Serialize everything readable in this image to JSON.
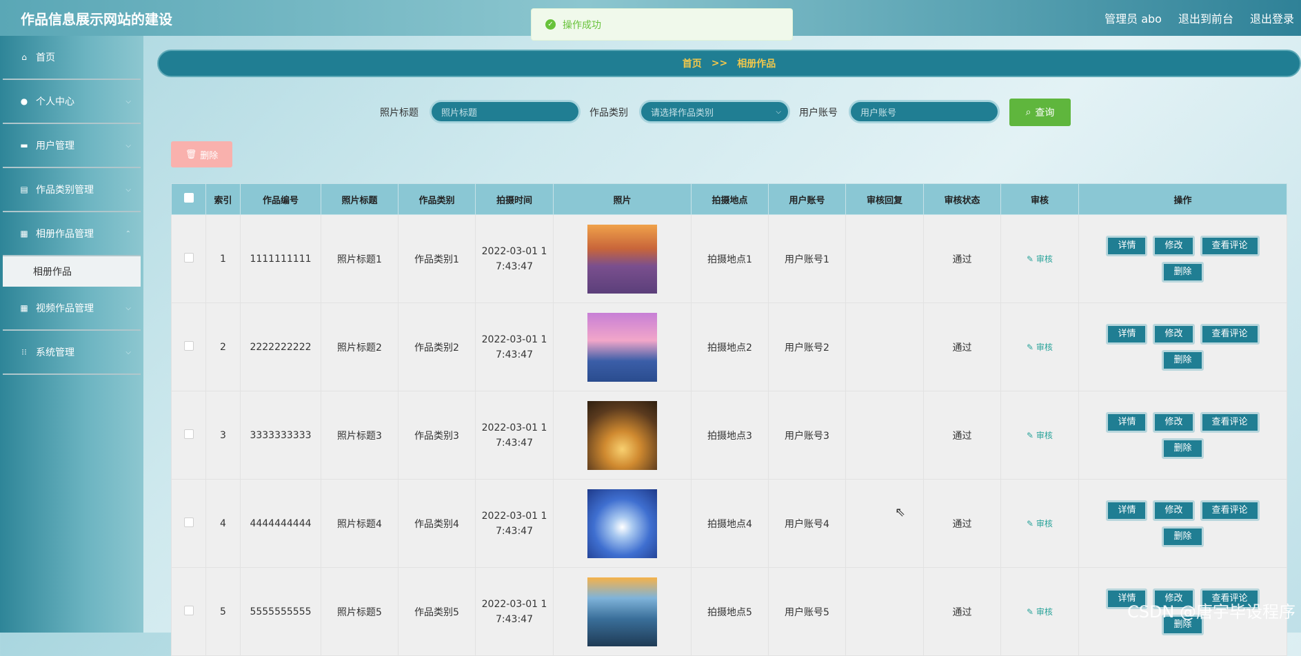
{
  "header": {
    "title": "作品信息展示网站的建设",
    "user_label": "管理员 abo",
    "to_front": "退出到前台",
    "logout": "退出登录"
  },
  "toast": {
    "message": "操作成功",
    "icon": "check-circle-icon"
  },
  "sidebar": {
    "items": [
      {
        "label": "首页",
        "icon": "home-icon"
      },
      {
        "label": "个人中心",
        "icon": "user-icon"
      },
      {
        "label": "用户管理",
        "icon": "briefcase-icon"
      },
      {
        "label": "作品类别管理",
        "icon": "clipboard-icon"
      },
      {
        "label": "相册作品管理",
        "icon": "ticket-icon"
      },
      {
        "label": "视频作品管理",
        "icon": "grid-icon"
      },
      {
        "label": "系统管理",
        "icon": "apps-icon"
      }
    ],
    "sub_active": "相册作品"
  },
  "breadcrumb": {
    "home": "首页",
    "sep": ">>",
    "current": "相册作品"
  },
  "search": {
    "label1": "照片标题",
    "placeholder1": "照片标题",
    "label2": "作品类别",
    "placeholder2": "请选择作品类别",
    "label3": "用户账号",
    "placeholder3": "用户账号",
    "query_label": "查询"
  },
  "batch_delete_label": "删除",
  "table": {
    "headers": [
      "",
      "索引",
      "作品编号",
      "照片标题",
      "作品类别",
      "拍摄时间",
      "照片",
      "拍摄地点",
      "用户账号",
      "审核回复",
      "审核状态",
      "审核",
      "操作"
    ],
    "rows": [
      {
        "index": "1",
        "code": "1111111111",
        "title": "照片标题1",
        "category": "作品类别1",
        "time1": "2022-03-01 1",
        "time2": "7:43:47",
        "place": "拍摄地点1",
        "account": "用户账号1",
        "reply": "",
        "status": "通过",
        "audit": "审核"
      },
      {
        "index": "2",
        "code": "2222222222",
        "title": "照片标题2",
        "category": "作品类别2",
        "time1": "2022-03-01 1",
        "time2": "7:43:47",
        "place": "拍摄地点2",
        "account": "用户账号2",
        "reply": "",
        "status": "通过",
        "audit": "审核"
      },
      {
        "index": "3",
        "code": "3333333333",
        "title": "照片标题3",
        "category": "作品类别3",
        "time1": "2022-03-01 1",
        "time2": "7:43:47",
        "place": "拍摄地点3",
        "account": "用户账号3",
        "reply": "",
        "status": "通过",
        "audit": "审核"
      },
      {
        "index": "4",
        "code": "4444444444",
        "title": "照片标题4",
        "category": "作品类别4",
        "time1": "2022-03-01 1",
        "time2": "7:43:47",
        "place": "拍摄地点4",
        "account": "用户账号4",
        "reply": "",
        "status": "通过",
        "audit": "审核"
      },
      {
        "index": "5",
        "code": "5555555555",
        "title": "照片标题5",
        "category": "作品类别5",
        "time1": "2022-03-01 1",
        "time2": "7:43:47",
        "place": "拍摄地点5",
        "account": "用户账号5",
        "reply": "",
        "status": "通过",
        "audit": "审核"
      }
    ],
    "ops": {
      "detail": "详情",
      "edit": "修改",
      "comments": "查看评论",
      "delete": "删除"
    }
  },
  "watermark": "CSDN @唐宇毕设程序",
  "colors": {
    "accent": "#207e93",
    "success": "#5fb63d",
    "danger_light": "#f9b1ad",
    "breadcrumb_text": "#f3c84b"
  }
}
